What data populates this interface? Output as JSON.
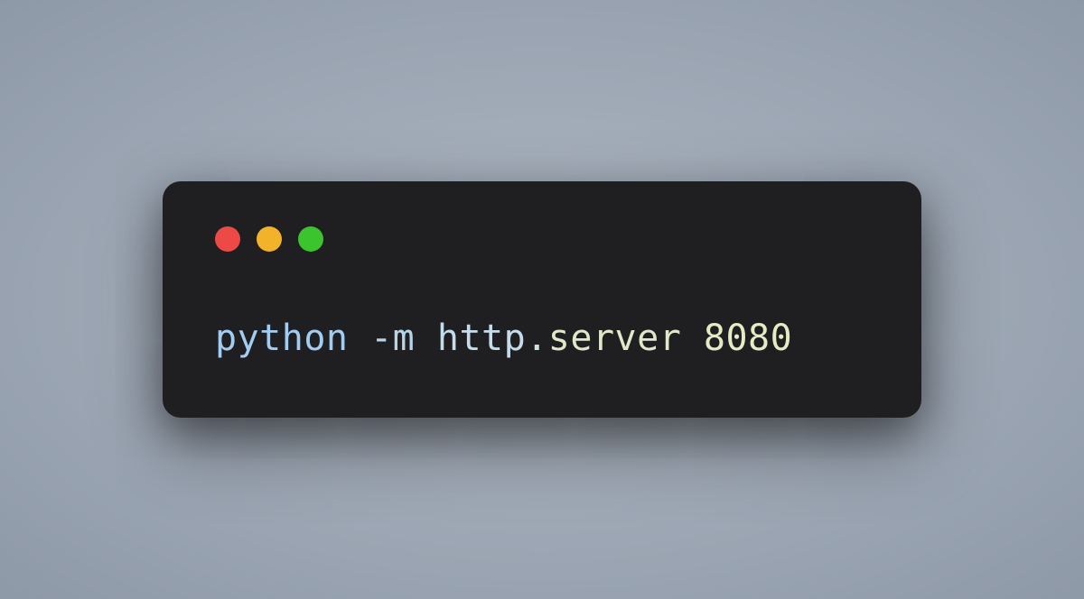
{
  "terminal": {
    "controls": {
      "close_color": "#ed4947",
      "minimize_color": "#f2b32a",
      "maximize_color": "#3cc42f"
    },
    "command": {
      "executable": "python",
      "flag": "-m",
      "module": "http",
      "dot": ".",
      "submodule": "server",
      "port": "8080"
    }
  }
}
